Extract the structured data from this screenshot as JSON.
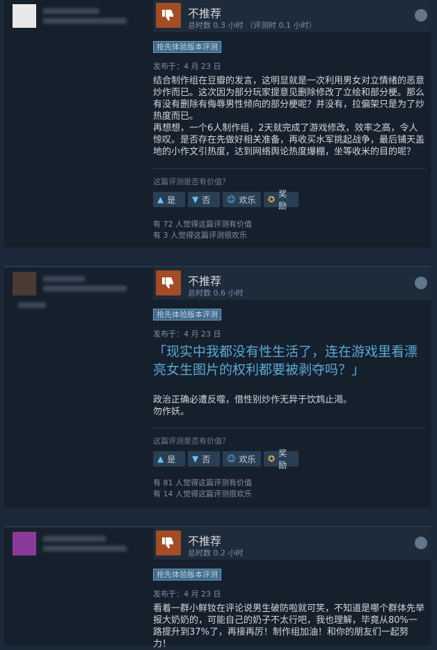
{
  "common": {
    "verdict": "不推荐",
    "early_access_tag": "抢先体验版本评测",
    "helpful_question": "这篇评测是否有价值？",
    "buttons": {
      "yes": "是",
      "no": "否",
      "funny": "欢乐",
      "award": "奖励"
    }
  },
  "reviews": [
    {
      "hours": "总时数 0.3 小时  （评测时 0.1 小时）",
      "posted": "发布于：4 月 23 日",
      "body": "结合制作组在豆瓣的发言，这明显就是一次利用男女对立情绪的恶意炒作而已。这次因为部分玩家提意见删除修改了立绘和部分梗。那么有没有删除有侮辱男性倾向的部分梗呢？并没有，拉偏架只是为了炒热度而已。\n再想想，一个6人制作组，2天就完成了游戏修改，效率之高，令人惊叹。是否存在先做好相关准备，再收买水军挑起战争，最后铺天盖地的小作文引热度，达到网络舆论热度爆棚，坐等收米的目的呢？",
      "helpful": "有 72 人觉得这篇评测有价值",
      "funny": "有 3 人觉得这篇评测很欢乐"
    },
    {
      "hours": "总时数 0.6 小时",
      "posted": "发布于：4 月 23 日",
      "quote": "「现实中我都没有性生活了，连在游戏里看漂亮女生图片的权利都要被剥夺吗？」",
      "body": "政治正确必遭反噬，借性别炒作无异于饮鸩止渴。\n勿作妖。",
      "helpful": "有 81 人觉得这篇评测有价值",
      "funny": "有 14 人觉得这篇评测很欢乐"
    },
    {
      "hours": "总时数 0.2 小时",
      "posted": "发布于：4 月 23 日",
      "body": "看着一群小鲜钕在评论说男生破防啦就可笑，不知道是哪个群体先举报大奶奶的，可能自己的奶子不太行吧，我也理解，毕竟从80%一路提升到37%了，再接再厉！制作组加油！和你的朋友们一起努力！"
    }
  ],
  "colors": {
    "thumb_down": "#a34c25",
    "accent": "#67c1f5",
    "bg": "#1b2838"
  }
}
